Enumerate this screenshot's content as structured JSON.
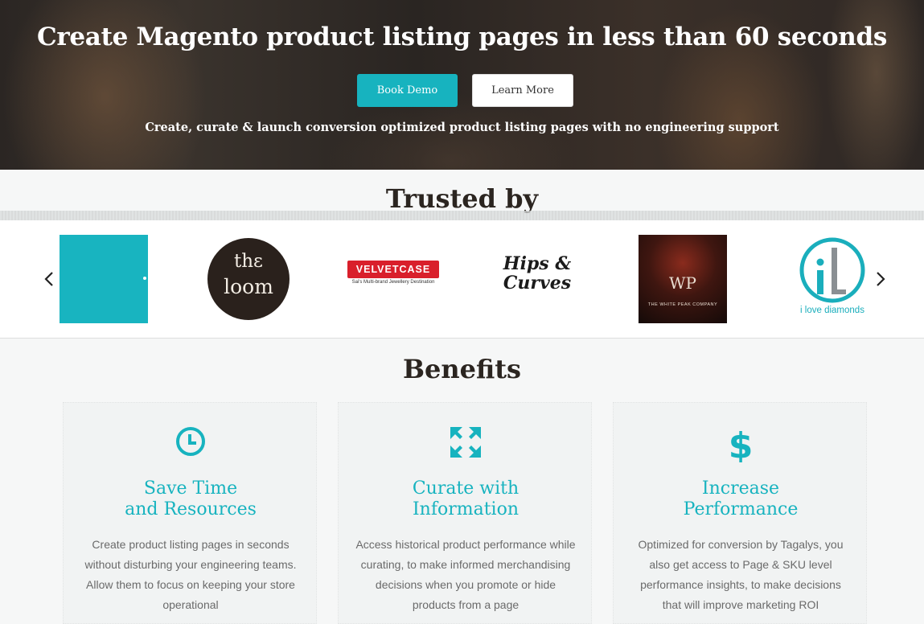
{
  "hero": {
    "title": "Create Magento product listing pages in less than 60 seconds",
    "book_demo_label": "Book Demo",
    "learn_more_label": "Learn More",
    "subtitle": "Create, curate & launch conversion optimized product listing pages with no engineering support"
  },
  "trusted": {
    "title": "Trusted by",
    "prev_arrow": "‹",
    "next_arrow": "›",
    "logos": {
      "loom_line1": "thε",
      "loom_line2": "loom",
      "velvetcase": "VELVETCASE",
      "velvetcase_tagline": "Sai's Multi-brand Jewellery Destination",
      "hips_line1": "Hips &",
      "hips_line2": "Curves",
      "whitepeak_mark": "WP",
      "whitepeak_name": "THE WHITE PEAK COMPANY",
      "ilovediamonds": "i love diamonds"
    }
  },
  "benefits": {
    "title": "Benefits",
    "cards": [
      {
        "icon": "clock-icon",
        "title": "Save Time\nand Resources",
        "text": "Create product listing pages in seconds without disturbing your engineering teams. Allow them to focus on keeping your store operational"
      },
      {
        "icon": "expand-arrows-icon",
        "title": "Curate with\nInformation",
        "text": "Access historical product performance while curating, to make informed merchandising decisions when you promote or hide products from a page"
      },
      {
        "icon": "dollar-icon",
        "title": "Increase\nPerformance",
        "text": "Optimized for conversion by Tagalys, you also get access to Page & SKU level performance insights, to make decisions that will improve marketing ROI"
      }
    ]
  },
  "colors": {
    "accent": "#17b3bf",
    "heading": "#2b2520",
    "body_text": "#6a6a6a"
  }
}
